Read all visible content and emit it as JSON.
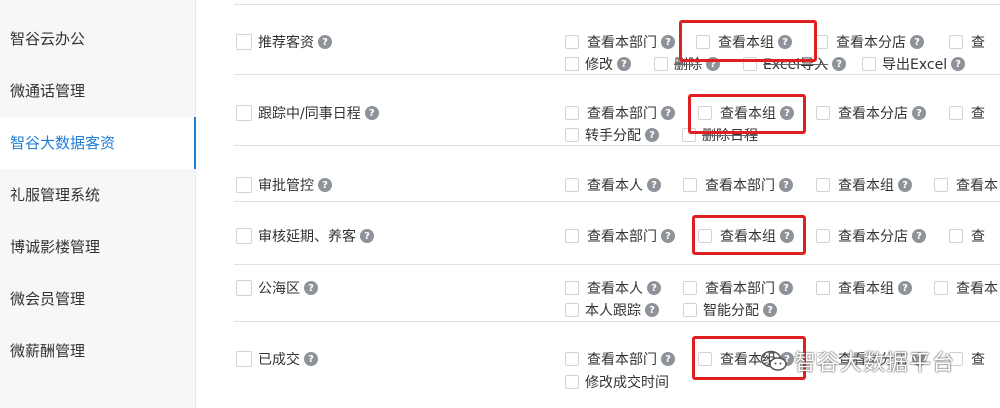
{
  "sidebar": {
    "items": [
      {
        "label": "智谷云办公"
      },
      {
        "label": "微通话管理"
      },
      {
        "label": "智谷大数据客资"
      },
      {
        "label": "礼服管理系统"
      },
      {
        "label": "博诚影楼管理"
      },
      {
        "label": "微会员管理"
      },
      {
        "label": "微薪酬管理"
      }
    ],
    "active_index": 2
  },
  "rows": [
    {
      "name": "推荐客资",
      "line1": [
        "查看本部门",
        "查看本组",
        "查看本分店",
        "查"
      ],
      "line2": [
        "修改",
        "删除",
        "Excel导入",
        "导出Excel"
      ]
    },
    {
      "name": "跟踪中/同事日程",
      "line1": [
        "查看本部门",
        "查看本组",
        "查看本分店",
        "查"
      ],
      "line2": [
        "转手分配",
        "删除日程"
      ]
    },
    {
      "name": "审批管控",
      "line1": [
        "查看本人",
        "查看本部门",
        "查看本组",
        "查看本"
      ]
    },
    {
      "name": "审核延期、养客",
      "line1": [
        "查看本部门",
        "查看本组",
        "查看本分店",
        "查"
      ]
    },
    {
      "name": "公海区",
      "line1": [
        "查看本人",
        "查看本部门",
        "查看本组",
        "查看本"
      ],
      "line2": [
        "本人跟踪",
        "智能分配"
      ]
    },
    {
      "name": "已成交",
      "line1": [
        "查看本部门",
        "查看本组",
        "查看本分店",
        "查"
      ],
      "line2": [
        "修改成交时间"
      ]
    }
  ],
  "help_glyph": "?",
  "watermark": {
    "text": "智谷大数据平台",
    "icon": "wechat-icon"
  },
  "colors": {
    "accent": "#1e7ed8",
    "highlight_box": "#e02020",
    "sidebar_bg": "#f6f7f9"
  }
}
